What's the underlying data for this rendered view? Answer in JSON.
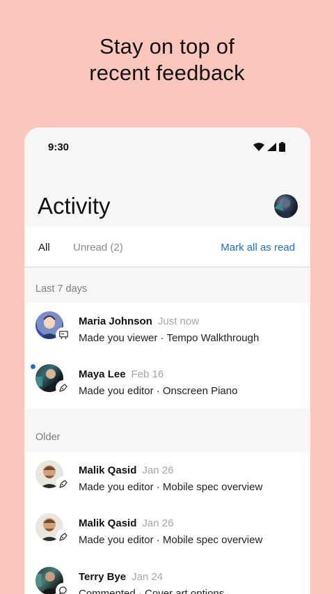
{
  "headline": {
    "line1": "Stay on top of",
    "line2": "recent feedback"
  },
  "status_bar": {
    "time": "9:30"
  },
  "header": {
    "title": "Activity"
  },
  "tabs": {
    "all": "All",
    "unread": "Unread (2)",
    "mark_all": "Mark all as read"
  },
  "sections": {
    "recent": "Last 7 days",
    "older": "Older"
  },
  "recent_items": [
    {
      "name": "Maria Johnson",
      "when": "Just now",
      "desc": "Made you viewer · Tempo Walkthrough",
      "badge_icon": "presentation-icon",
      "unread": false
    },
    {
      "name": "Maya Lee",
      "when": "Feb 16",
      "desc": "Made you editor · Onscreen Piano",
      "badge_icon": "pen-nib-icon",
      "unread": true
    }
  ],
  "older_items": [
    {
      "name": "Malik Qasid",
      "when": "Jan 26",
      "desc": "Made you editor · Mobile spec overview",
      "badge_icon": "pen-nib-icon"
    },
    {
      "name": "Malik Qasid",
      "when": "Jan 26",
      "desc": "Made you editor · Mobile spec overview",
      "badge_icon": "pen-nib-icon"
    },
    {
      "name": "Terry Bye",
      "when": "Jan 24",
      "desc": "Commented · Cover art options",
      "badge_icon": "comment-icon"
    }
  ],
  "colors": {
    "background": "#fcc6bd",
    "accent": "#1d6fd0",
    "unread_dot": "#1d6fd0"
  }
}
